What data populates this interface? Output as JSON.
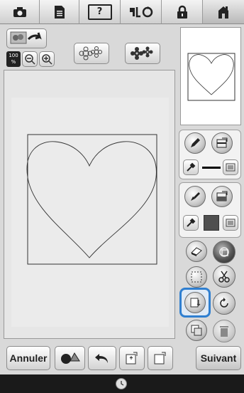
{
  "top_tabs": [
    {
      "name": "camera-icon"
    },
    {
      "name": "document-icon"
    },
    {
      "name": "frame-help-icon",
      "text": "?"
    },
    {
      "name": "stitch-settings-icon"
    },
    {
      "name": "lock-icon"
    },
    {
      "name": "home-icon"
    }
  ],
  "zoom": {
    "level_label": "100\n%",
    "minus": "−",
    "plus": "+"
  },
  "bottom_bar": {
    "cancel_label": "Annuler",
    "next_label": "Suivant"
  },
  "colors": {
    "accent_highlight": "#2f7fd0",
    "line_color": "#000000",
    "fill_color": "#4f4f4f"
  }
}
